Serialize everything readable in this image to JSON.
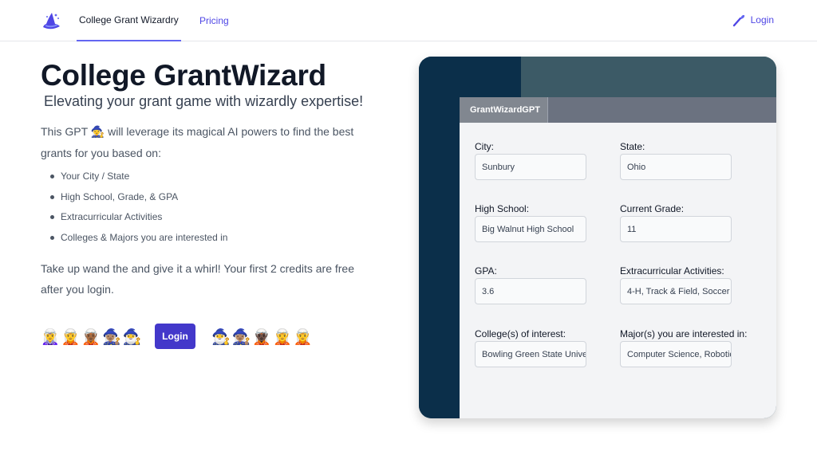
{
  "nav": {
    "logo_icon": "wizard-hat-icon",
    "tabs": [
      {
        "label": "College Grant Wizardry",
        "active": true
      },
      {
        "label": "Pricing",
        "active": false
      }
    ],
    "login_label": "Login",
    "login_icon": "magic-wand-icon"
  },
  "hero": {
    "title": "College GrantWizard",
    "subtitle": "Elevating your grant game with wizardly expertise!",
    "intro_before": "This GPT",
    "intro_emoji": "🧙‍♀️",
    "intro_after": "will leverage its magical AI powers to find the best grants for you based on:",
    "bullets": [
      "Your City / State",
      "High School, Grade, & GPA",
      "Extracurricular Activities",
      "Colleges & Majors you are interested in"
    ],
    "cta": "Take up wand the and give it a whirl! Your first 2 credits are free after you login.",
    "login_button": "Login",
    "emojis_left": [
      "🧝‍♀️",
      "🧝",
      "🧝🏾",
      "🧙🏽‍♀️",
      "🧙‍♂️"
    ],
    "emojis_right": [
      "🧙‍♂️",
      "🧙🏽‍♀️",
      "🧝🏿",
      "🧝",
      "🧝"
    ]
  },
  "app": {
    "tab_label": "GrantWizardGPT",
    "fields": [
      {
        "label": "City:",
        "value": "Sunbury"
      },
      {
        "label": "State:",
        "value": "Ohio"
      },
      {
        "label": "High School:",
        "value": "Big Walnut High School"
      },
      {
        "label": "Current Grade:",
        "value": "11"
      },
      {
        "label": "GPA:",
        "value": "3.6"
      },
      {
        "label": "Extracurricular Activities:",
        "value": "4-H, Track & Field, Soccer"
      },
      {
        "label": "College(s) of interest:",
        "value": "Bowling Green State University"
      },
      {
        "label": "Major(s) you are interested in:",
        "value": "Computer Science, Robotics"
      }
    ]
  },
  "colors": {
    "accent": "#4f46e5",
    "button": "#4338ca",
    "preview_left": "#0b2f4a",
    "preview_top": "#3c5a66"
  }
}
